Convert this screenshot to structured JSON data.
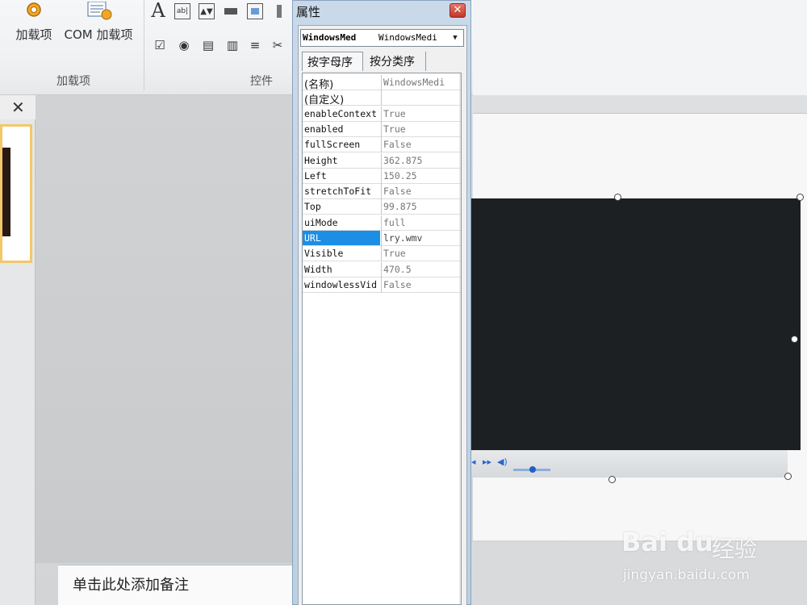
{
  "ribbon": {
    "addins_label": "加载项",
    "com_addins_label": "COM 加载项",
    "group_addins": "加载项",
    "group_controls": "控件"
  },
  "thumbs": {
    "close": "✕"
  },
  "notes": {
    "placeholder": "单击此处添加备注"
  },
  "properties": {
    "title": "属性",
    "close": "✕",
    "object_name": "WindowsMed",
    "object_type": "WindowsMedi",
    "tabs": [
      "按字母序",
      "按分类序"
    ],
    "rows": [
      {
        "name": "(名称)",
        "value": "WindowsMedi"
      },
      {
        "name": "(自定义)",
        "value": ""
      },
      {
        "name": "enableContext",
        "value": "True"
      },
      {
        "name": "enabled",
        "value": "True"
      },
      {
        "name": "fullScreen",
        "value": "False"
      },
      {
        "name": "Height",
        "value": "362.875"
      },
      {
        "name": "Left",
        "value": "150.25"
      },
      {
        "name": "stretchToFit",
        "value": "False"
      },
      {
        "name": "Top",
        "value": "99.875"
      },
      {
        "name": "uiMode",
        "value": "full"
      },
      {
        "name": "URL",
        "value": "lry.wmv"
      },
      {
        "name": "Visible",
        "value": "True"
      },
      {
        "name": "Width",
        "value": "470.5"
      },
      {
        "name": "windowlessVid",
        "value": "False"
      }
    ],
    "selected_index": 10
  },
  "watermark": {
    "logo": "Bai du",
    "cn": "经验",
    "url": "jingyan.baidu.com"
  },
  "colors": {
    "selection": "#1c8ee6",
    "video_bg": "#1d2022",
    "thumb_border": "#f3c76a"
  }
}
